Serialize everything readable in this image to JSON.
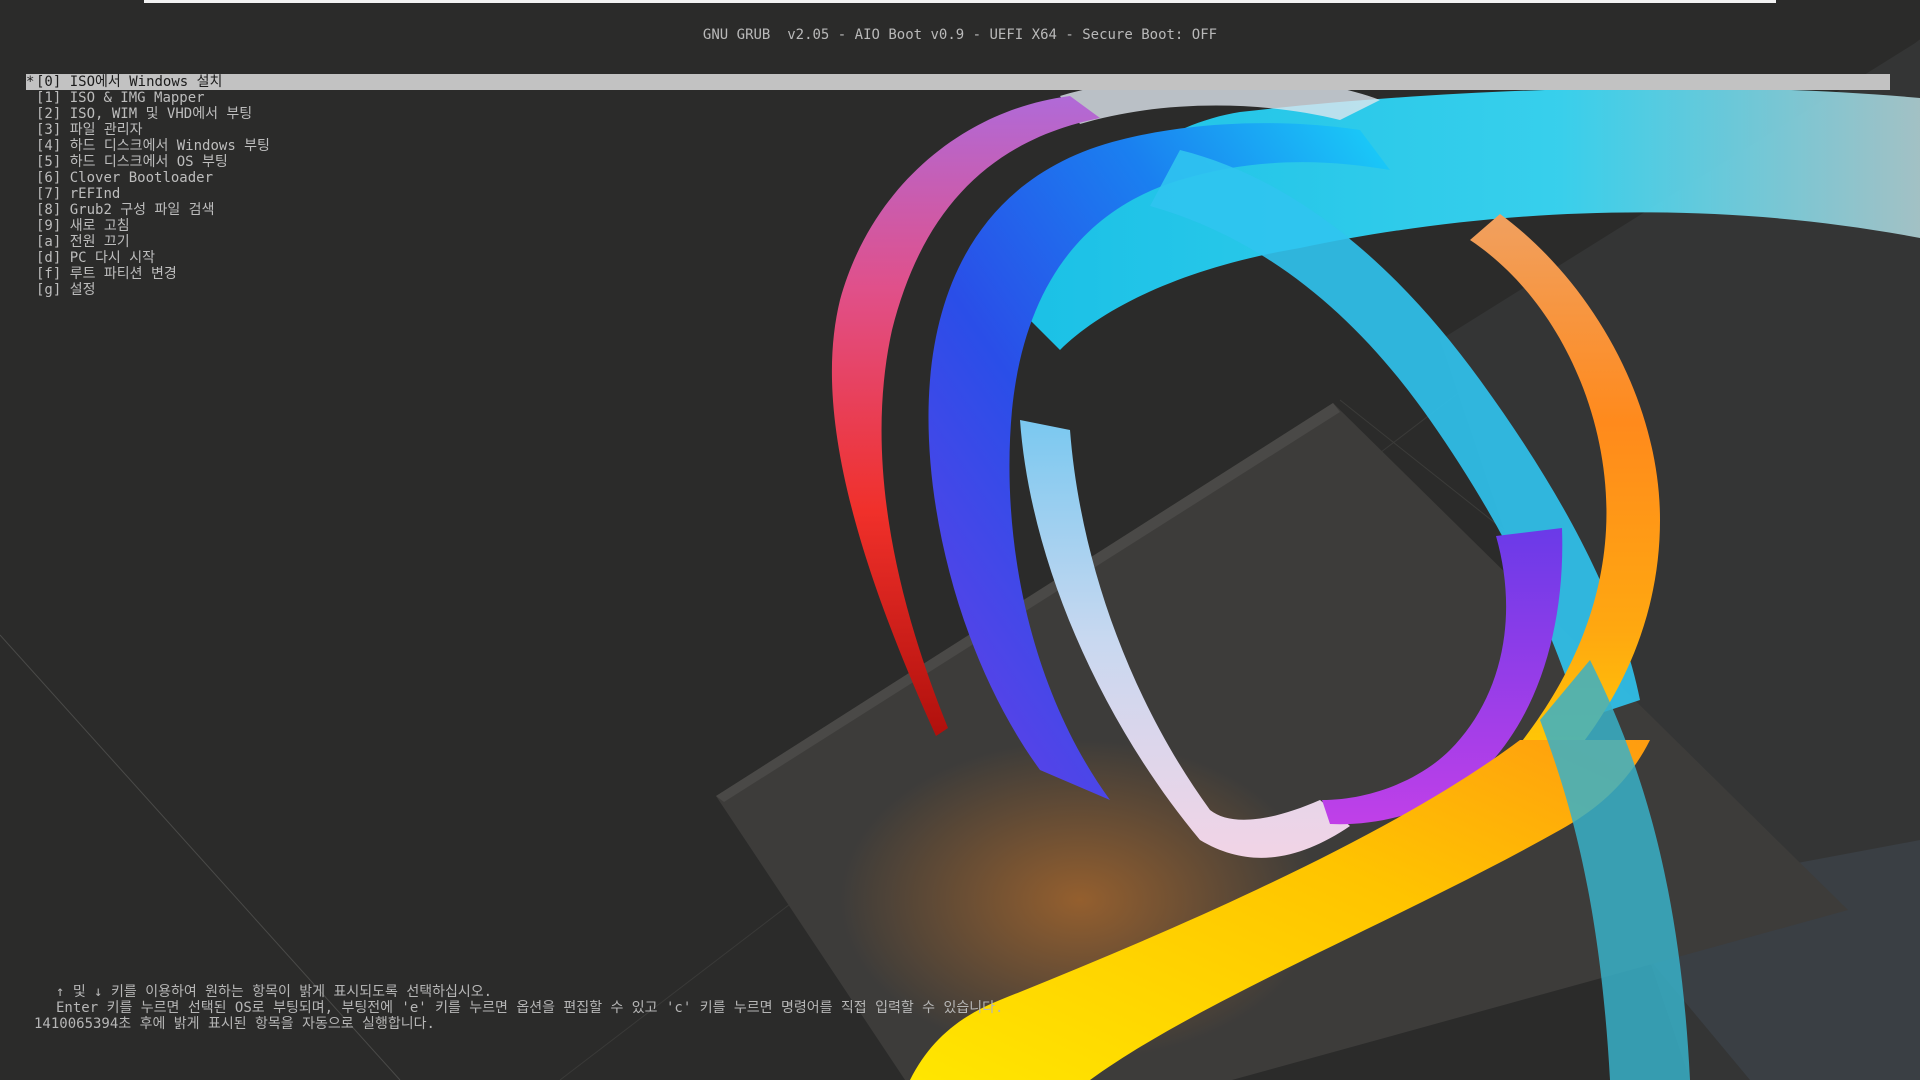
{
  "header": {
    "title": "GNU GRUB  v2.05 - AIO Boot v0.9 - UEFI X64 - Secure Boot: OFF"
  },
  "menu": {
    "selected_marker": "*",
    "items": [
      {
        "key": "[0]",
        "label": "ISO에서 Windows 설치"
      },
      {
        "key": "[1]",
        "label": "ISO & IMG Mapper"
      },
      {
        "key": "[2]",
        "label": "ISO, WIM 및 VHD에서 부팅"
      },
      {
        "key": "[3]",
        "label": "파일 관리자"
      },
      {
        "key": "[4]",
        "label": "하드 디스크에서 Windows 부팅"
      },
      {
        "key": "[5]",
        "label": "하드 디스크에서 OS 부팅"
      },
      {
        "key": "[6]",
        "label": "Clover Bootloader"
      },
      {
        "key": "[7]",
        "label": "rEFInd"
      },
      {
        "key": "[8]",
        "label": "Grub2 구성 파일 검색"
      },
      {
        "key": "[9]",
        "label": "새로 고침"
      },
      {
        "key": "[a]",
        "label": "전원 끄기"
      },
      {
        "key": "[d]",
        "label": "PC 다시 시작"
      },
      {
        "key": "[f]",
        "label": "루트 파티션 변경"
      },
      {
        "key": "[g]",
        "label": "설정"
      }
    ]
  },
  "help": {
    "line1": "↑ 및 ↓ 키를 이용하여 원하는 항목이 밝게 표시되도록 선택하십시오.",
    "line2": "Enter 키를 누르면 선택된 OS로 부팅되며, 부팅전에 'e' 키를 누르면 옵션을 편집할 수 있고 'c' 키를 누르면 명령어를 직접 입력할 수 있습니다.",
    "line3": "1410065394초 후에 밝게 표시된 항목을 자동으로 실행합니다."
  },
  "colors": {
    "background": "#2b2b2a",
    "text": "#bdbdbd",
    "highlight_bg": "#c2c2c2",
    "highlight_text": "#1b1b1b"
  },
  "icons": [
    "ribbon-artwork-wallpaper"
  ]
}
